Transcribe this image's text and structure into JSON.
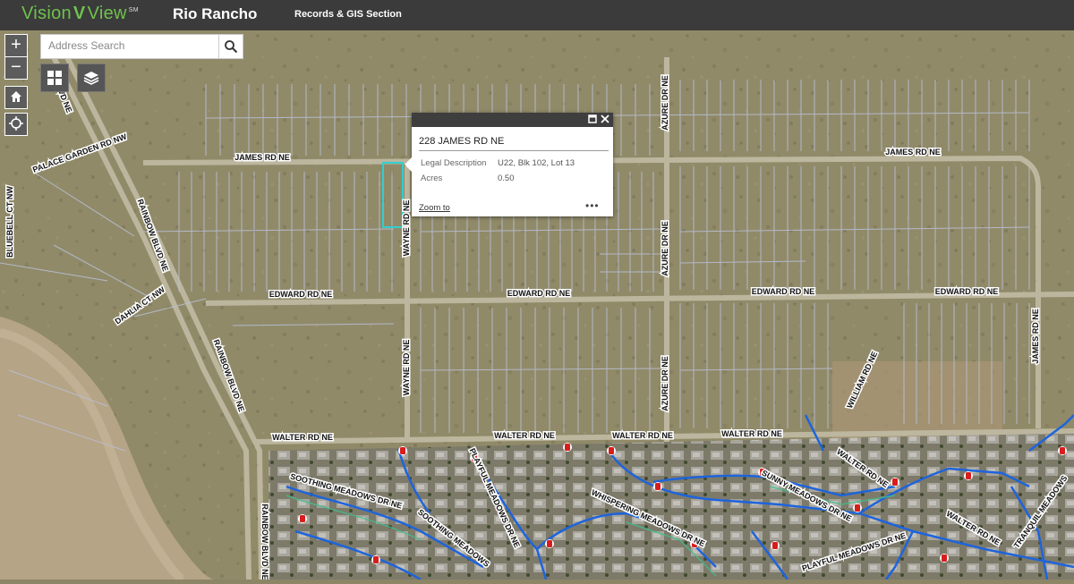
{
  "header": {
    "brand_left": "Vision",
    "brand_mark": "V",
    "brand_right": "View",
    "brand_tm": "SM",
    "city": "Rio Rancho",
    "section": "Records & GIS Section"
  },
  "controls": {
    "zoom_in": "+",
    "zoom_out": "−",
    "search_placeholder": "Address Search"
  },
  "popup": {
    "title": "228 JAMES RD NE",
    "fields": [
      {
        "label": "Legal Description",
        "value": "U22, Blk 102, Lot 13"
      },
      {
        "label": "Acres",
        "value": "0.50"
      }
    ],
    "zoom_link": "Zoom to",
    "more": "•••"
  },
  "road_labels": [
    "PALACE GARDEN RD NW",
    "JAMES RD NE",
    "JAMES RD NE",
    "BLUEBELL CT NW",
    "RAINBOW BLVD NE",
    "RAINBOW BLVD NE",
    "RAINBOW BLVD NE",
    "DAHLIA CT NW",
    "WAYNE RD NE",
    "WAYNE RD NE",
    "AZURE DR NE",
    "AZURE DR NE",
    "AZURE DR NE",
    "EDWARD RD NE",
    "EDWARD RD NE",
    "EDWARD RD NE",
    "EDWARD RD NE",
    "JAMES RD NE",
    "WILLIAM RD NE",
    "WALTER RD NE",
    "WALTER RD NE",
    "WALTER RD NE",
    "WALTER RD NE",
    "WALTER RD NE",
    "WALTER RD NE",
    "SOOTHING MEADOWS DR NE",
    "SOOTHING MEADOWS",
    "PLAYFUL MEADOWS DR NE",
    "WHISPERING MEADOWS DR NE",
    "SUNNY MEADOWS DR NE",
    "PLAYFUL MEADOWS DR NE",
    "TRANQUIL MEADOWS",
    "VD NE"
  ],
  "colors": {
    "header_bg": "#3b3b3b",
    "brand_green": "#6fc24d",
    "parcel_line": "#b9bed2",
    "selected_parcel": "#2fd0d0",
    "water_line": "#1e64dc",
    "hydrant": "#d91c1c"
  }
}
